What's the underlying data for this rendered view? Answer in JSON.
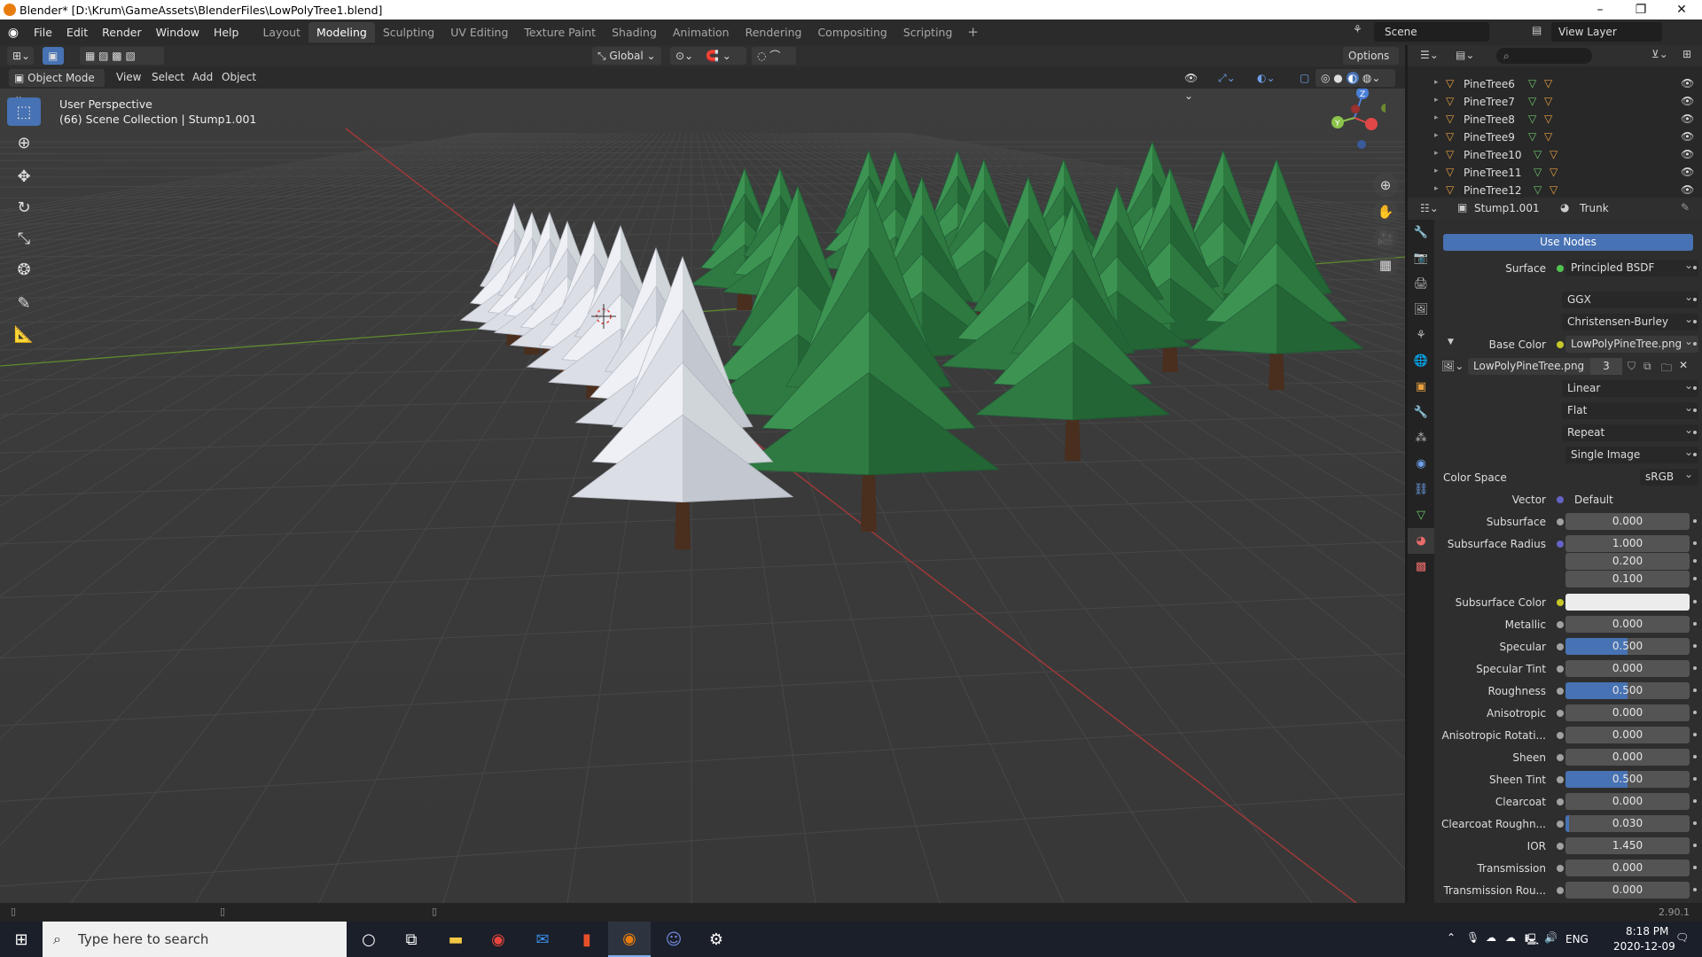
{
  "window": {
    "title": "Blender* [D:\\Krum\\GameAssets\\BlenderFiles\\LowPolyTree1.blend]",
    "controls": [
      "–",
      "❐",
      "✕"
    ]
  },
  "menus": [
    "File",
    "Edit",
    "Render",
    "Window",
    "Help"
  ],
  "workspaces": [
    "Layout",
    "Modeling",
    "Sculpting",
    "UV Editing",
    "Texture Paint",
    "Shading",
    "Animation",
    "Rendering",
    "Compositing",
    "Scripting"
  ],
  "active_workspace": "Modeling",
  "scene": "Scene",
  "view_layer": "View Layer",
  "viewport_header": {
    "orientation": "Global",
    "options": "Options",
    "mode": "Object Mode",
    "menu": [
      "View",
      "Select",
      "Add",
      "Object"
    ]
  },
  "viewport": {
    "line1": "User Perspective",
    "line2": "(66) Scene Collection | Stump1.001"
  },
  "outliner": {
    "rows": [
      "PineTree6",
      "PineTree7",
      "PineTree8",
      "PineTree9",
      "PineTree10",
      "PineTree11",
      "PineTree12"
    ]
  },
  "props_header": {
    "object": "Stump1.001",
    "material": "Trunk"
  },
  "material": {
    "use_nodes": "Use Nodes",
    "surface_label": "Surface",
    "surface_value": "Principled BSDF",
    "distribution": "GGX",
    "subsurface_method": "Christensen-Burley",
    "base_color_label": "Base Color",
    "base_color_value": "LowPolyPineTree.png",
    "image_name": "LowPolyPineTree.png",
    "image_users": "3",
    "interpolation": "Linear",
    "projection": "Flat",
    "extension": "Repeat",
    "source": "Single Image",
    "color_space_label": "Color Space",
    "color_space_value": "sRGB",
    "vector_label": "Vector",
    "vector_value": "Default",
    "params": [
      {
        "label": "Subsurface",
        "value": "0.000",
        "fill": 0,
        "dot": "#a1a1a1"
      },
      {
        "label": "Subsurface Radius",
        "value": "1.000",
        "fill": 0,
        "dot": "#6363c7"
      },
      {
        "label": "",
        "value": "0.200",
        "fill": 0,
        "dot": ""
      },
      {
        "label": "",
        "value": "0.100",
        "fill": 0,
        "dot": ""
      },
      {
        "label": "Subsurface Color",
        "value": "",
        "fill": 0,
        "dot": "#c7c729"
      },
      {
        "label": "Metallic",
        "value": "0.000",
        "fill": 0,
        "dot": "#a1a1a1"
      },
      {
        "label": "Specular",
        "value": "0.500",
        "fill": 0.5,
        "dot": "#a1a1a1"
      },
      {
        "label": "Specular Tint",
        "value": "0.000",
        "fill": 0,
        "dot": "#a1a1a1"
      },
      {
        "label": "Roughness",
        "value": "0.500",
        "fill": 0.5,
        "dot": "#a1a1a1"
      },
      {
        "label": "Anisotropic",
        "value": "0.000",
        "fill": 0,
        "dot": "#a1a1a1"
      },
      {
        "label": "Anisotropic Rotati...",
        "value": "0.000",
        "fill": 0,
        "dot": "#a1a1a1"
      },
      {
        "label": "Sheen",
        "value": "0.000",
        "fill": 0,
        "dot": "#a1a1a1"
      },
      {
        "label": "Sheen Tint",
        "value": "0.500",
        "fill": 0.5,
        "dot": "#a1a1a1"
      },
      {
        "label": "Clearcoat",
        "value": "0.000",
        "fill": 0,
        "dot": "#a1a1a1"
      },
      {
        "label": "Clearcoat Roughn...",
        "value": "0.030",
        "fill": 0.03,
        "dot": "#a1a1a1"
      },
      {
        "label": "IOR",
        "value": "1.450",
        "fill": 0,
        "dot": "#a1a1a1"
      },
      {
        "label": "Transmission",
        "value": "0.000",
        "fill": 0,
        "dot": "#a1a1a1"
      },
      {
        "label": "Transmission Rou...",
        "value": "0.000",
        "fill": 0,
        "dot": "#a1a1a1"
      }
    ]
  },
  "version": "2.90.1",
  "taskbar": {
    "search_placeholder": "Type here to search",
    "time": "8:18 PM",
    "date": "2020-12-09",
    "lang": "ENG"
  },
  "colors": {
    "accent": "#4772b3",
    "blender_orange": "#e87d0d",
    "tree_green": "#3f8f4d",
    "snow": "#e7e9ef"
  }
}
